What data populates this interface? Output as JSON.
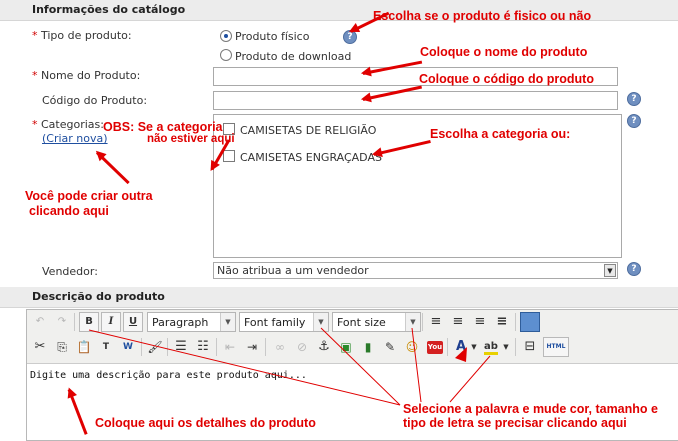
{
  "catalog": {
    "section_title": "Informações do catálogo",
    "product_type": {
      "label": "Tipo de produto:",
      "options": [
        "Produto físico",
        "Produto de download"
      ],
      "selected": "Produto físico"
    },
    "name_label": "Nome do Produto:",
    "code_label": "Código do Produto:",
    "categories": {
      "label": "Categorias:",
      "create_link": "(Criar nova)",
      "items": [
        "CAMISETAS DE RELIGIÃO",
        "CAMISETAS ENGRAÇADAS"
      ]
    },
    "seller": {
      "label": "Vendedor:",
      "value": "Não atribua a um vendedor"
    },
    "required_mark": "*",
    "help_glyph": "?"
  },
  "description": {
    "section_title": "Descrição do produto",
    "toolbar": {
      "bold": "B",
      "italic": "I",
      "underline": "U",
      "format_select": "Paragraph",
      "font_family_select": "Font family",
      "font_size_select": "Font size",
      "html_button": "HTML",
      "youtube_label": "You"
    },
    "editor_text": "Digite uma descrição para este produto aqui..."
  },
  "annotations": {
    "type_note": "Escolha se o produto é fisico ou não",
    "name_note": "Coloque o nome do produto",
    "code_note": "Coloque o código do produto",
    "obs_note_1": "OBS: Se a categoria",
    "obs_note_2": "não estiver aqui",
    "category_note": "Escolha a categoria ou:",
    "create_note_1": "Você pode criar outra",
    "create_note_2": "clicando aqui",
    "details_note": "Coloque aqui os detalhes do produto",
    "format_note_1": "Selecione a palavra e mude cor, tamanho e",
    "format_note_2": "tipo de letra se precisar clicando aqui"
  },
  "colors": {
    "annotation": "#e00000",
    "section_header": "#ececec",
    "help_icon": "#6f8fc0",
    "link": "#1f4fa0"
  }
}
